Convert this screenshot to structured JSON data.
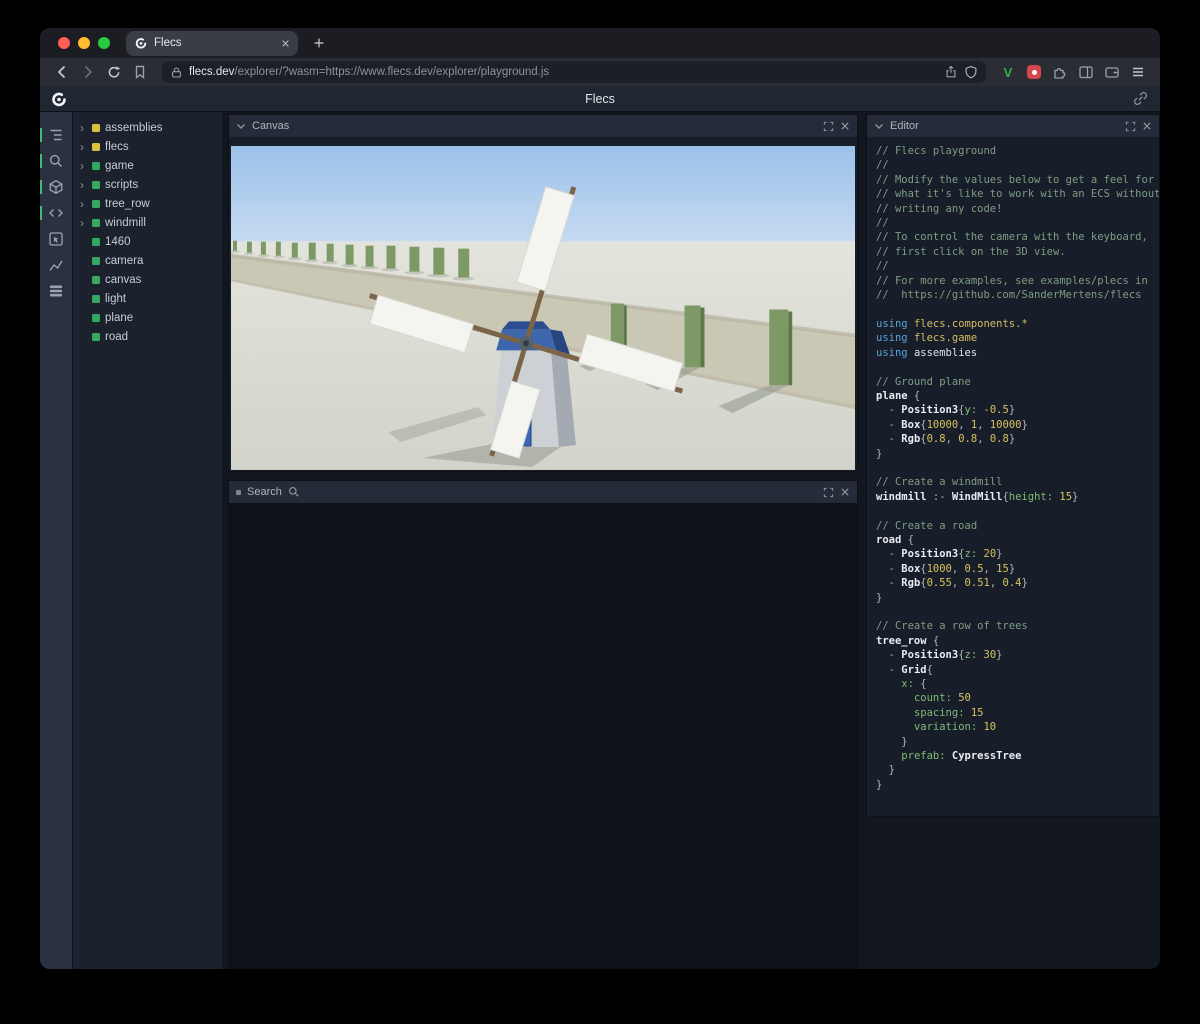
{
  "browser": {
    "tab_title": "Flecs",
    "url_domain": "flecs.dev",
    "url_path": "/explorer/?wasm=https://www.flecs.dev/explorer/playground.js",
    "extensions": {
      "v_label": "V"
    }
  },
  "header": {
    "title": "Flecs"
  },
  "toolbar": {
    "icons": [
      {
        "name": "entity-tree",
        "active": true
      },
      {
        "name": "search",
        "active": true
      },
      {
        "name": "assets",
        "active": true
      },
      {
        "name": "code",
        "active": true
      },
      {
        "name": "inspector",
        "active": false
      },
      {
        "name": "stats",
        "active": false
      },
      {
        "name": "queries",
        "active": false
      }
    ]
  },
  "entity_tree": {
    "items": [
      {
        "label": "assemblies",
        "type": "module",
        "expandable": true
      },
      {
        "label": "flecs",
        "type": "module",
        "expandable": true
      },
      {
        "label": "game",
        "type": "entity",
        "expandable": true
      },
      {
        "label": "scripts",
        "type": "entity",
        "expandable": true
      },
      {
        "label": "tree_row",
        "type": "entity",
        "expandable": true
      },
      {
        "label": "windmill",
        "type": "entity",
        "expandable": true
      },
      {
        "label": "1460",
        "type": "entity",
        "expandable": false
      },
      {
        "label": "camera",
        "type": "entity",
        "expandable": false
      },
      {
        "label": "canvas",
        "type": "entity",
        "expandable": false
      },
      {
        "label": "light",
        "type": "entity",
        "expandable": false
      },
      {
        "label": "plane",
        "type": "entity",
        "expandable": false
      },
      {
        "label": "road",
        "type": "entity",
        "expandable": false
      }
    ]
  },
  "panels": {
    "canvas": {
      "title": "Canvas"
    },
    "search": {
      "title": "Search"
    },
    "editor": {
      "title": "Editor"
    }
  },
  "colors": {
    "module_square": "#d9c33c",
    "entity_square": "#35a75f",
    "accent_green": "#43b97c",
    "editor_comment": "#7e9c82",
    "editor_keyword": "#56a2d8",
    "editor_number": "#d8c25e",
    "editor_attr": "#7fbb76"
  },
  "editor": {
    "lines": [
      [
        {
          "s": "c",
          "t": "// Flecs playground"
        }
      ],
      [
        {
          "s": "c",
          "t": "//"
        }
      ],
      [
        {
          "s": "c",
          "t": "// Modify the values below to get a feel for"
        }
      ],
      [
        {
          "s": "c",
          "t": "// what it's like to work with an ECS without"
        }
      ],
      [
        {
          "s": "c",
          "t": "// writing any code!"
        }
      ],
      [
        {
          "s": "c",
          "t": "//"
        }
      ],
      [
        {
          "s": "c",
          "t": "// To control the camera with the keyboard,"
        }
      ],
      [
        {
          "s": "c",
          "t": "// first click on the 3D view."
        }
      ],
      [
        {
          "s": "c",
          "t": "//"
        }
      ],
      [
        {
          "s": "c",
          "t": "// For more examples, see examples/plecs in"
        }
      ],
      [
        {
          "s": "c",
          "t": "//  https://github.com/SanderMertens/flecs"
        }
      ],
      [],
      [
        {
          "s": "k",
          "t": "using"
        },
        {
          "s": "p",
          "t": " "
        },
        {
          "s": "m",
          "t": "flecs.components.*"
        }
      ],
      [
        {
          "s": "k",
          "t": "using"
        },
        {
          "s": "p",
          "t": " "
        },
        {
          "s": "m",
          "t": "flecs.game"
        }
      ],
      [
        {
          "s": "k",
          "t": "using"
        },
        {
          "s": "p",
          "t": " "
        },
        {
          "s": "w",
          "t": "assemblies"
        }
      ],
      [],
      [
        {
          "s": "c",
          "t": "// Ground plane"
        }
      ],
      [
        {
          "s": "e",
          "t": "plane"
        },
        {
          "s": "p",
          "t": " {"
        }
      ],
      [
        {
          "s": "p",
          "t": "  - "
        },
        {
          "s": "e",
          "t": "Position3"
        },
        {
          "s": "p",
          "t": "{"
        },
        {
          "s": "a",
          "t": "y:"
        },
        {
          "s": "p",
          "t": " "
        },
        {
          "s": "n",
          "t": "-0.5"
        },
        {
          "s": "p",
          "t": "}"
        }
      ],
      [
        {
          "s": "p",
          "t": "  - "
        },
        {
          "s": "e",
          "t": "Box"
        },
        {
          "s": "p",
          "t": "{"
        },
        {
          "s": "n",
          "t": "10000"
        },
        {
          "s": "p",
          "t": ", "
        },
        {
          "s": "n",
          "t": "1"
        },
        {
          "s": "p",
          "t": ", "
        },
        {
          "s": "n",
          "t": "10000"
        },
        {
          "s": "p",
          "t": "}"
        }
      ],
      [
        {
          "s": "p",
          "t": "  - "
        },
        {
          "s": "e",
          "t": "Rgb"
        },
        {
          "s": "p",
          "t": "{"
        },
        {
          "s": "n",
          "t": "0.8"
        },
        {
          "s": "p",
          "t": ", "
        },
        {
          "s": "n",
          "t": "0.8"
        },
        {
          "s": "p",
          "t": ", "
        },
        {
          "s": "n",
          "t": "0.8"
        },
        {
          "s": "p",
          "t": "}"
        }
      ],
      [
        {
          "s": "p",
          "t": "}"
        }
      ],
      [],
      [
        {
          "s": "c",
          "t": "// Create a windmill"
        }
      ],
      [
        {
          "s": "e",
          "t": "windmill"
        },
        {
          "s": "p",
          "t": " :- "
        },
        {
          "s": "e",
          "t": "WindMill"
        },
        {
          "s": "p",
          "t": "{"
        },
        {
          "s": "a",
          "t": "height:"
        },
        {
          "s": "p",
          "t": " "
        },
        {
          "s": "n",
          "t": "15"
        },
        {
          "s": "p",
          "t": "}"
        }
      ],
      [],
      [
        {
          "s": "c",
          "t": "// Create a road"
        }
      ],
      [
        {
          "s": "e",
          "t": "road"
        },
        {
          "s": "p",
          "t": " {"
        }
      ],
      [
        {
          "s": "p",
          "t": "  - "
        },
        {
          "s": "e",
          "t": "Position3"
        },
        {
          "s": "p",
          "t": "{"
        },
        {
          "s": "a",
          "t": "z:"
        },
        {
          "s": "p",
          "t": " "
        },
        {
          "s": "n",
          "t": "20"
        },
        {
          "s": "p",
          "t": "}"
        }
      ],
      [
        {
          "s": "p",
          "t": "  - "
        },
        {
          "s": "e",
          "t": "Box"
        },
        {
          "s": "p",
          "t": "{"
        },
        {
          "s": "n",
          "t": "1000"
        },
        {
          "s": "p",
          "t": ", "
        },
        {
          "s": "n",
          "t": "0.5"
        },
        {
          "s": "p",
          "t": ", "
        },
        {
          "s": "n",
          "t": "15"
        },
        {
          "s": "p",
          "t": "}"
        }
      ],
      [
        {
          "s": "p",
          "t": "  - "
        },
        {
          "s": "e",
          "t": "Rgb"
        },
        {
          "s": "p",
          "t": "{"
        },
        {
          "s": "n",
          "t": "0.55"
        },
        {
          "s": "p",
          "t": ", "
        },
        {
          "s": "n",
          "t": "0.51"
        },
        {
          "s": "p",
          "t": ", "
        },
        {
          "s": "n",
          "t": "0.4"
        },
        {
          "s": "p",
          "t": "}"
        }
      ],
      [
        {
          "s": "p",
          "t": "}"
        }
      ],
      [],
      [
        {
          "s": "c",
          "t": "// Create a row of trees"
        }
      ],
      [
        {
          "s": "e",
          "t": "tree_row"
        },
        {
          "s": "p",
          "t": " {"
        }
      ],
      [
        {
          "s": "p",
          "t": "  - "
        },
        {
          "s": "e",
          "t": "Position3"
        },
        {
          "s": "p",
          "t": "{"
        },
        {
          "s": "a",
          "t": "z:"
        },
        {
          "s": "p",
          "t": " "
        },
        {
          "s": "n",
          "t": "30"
        },
        {
          "s": "p",
          "t": "}"
        }
      ],
      [
        {
          "s": "p",
          "t": "  - "
        },
        {
          "s": "e",
          "t": "Grid"
        },
        {
          "s": "p",
          "t": "{"
        }
      ],
      [
        {
          "s": "p",
          "t": "    "
        },
        {
          "s": "a",
          "t": "x:"
        },
        {
          "s": "p",
          "t": " {"
        }
      ],
      [
        {
          "s": "p",
          "t": "      "
        },
        {
          "s": "a",
          "t": "count:"
        },
        {
          "s": "p",
          "t": " "
        },
        {
          "s": "n",
          "t": "50"
        }
      ],
      [
        {
          "s": "p",
          "t": "      "
        },
        {
          "s": "a",
          "t": "spacing:"
        },
        {
          "s": "p",
          "t": " "
        },
        {
          "s": "n",
          "t": "15"
        }
      ],
      [
        {
          "s": "p",
          "t": "      "
        },
        {
          "s": "a",
          "t": "variation:"
        },
        {
          "s": "p",
          "t": " "
        },
        {
          "s": "n",
          "t": "10"
        }
      ],
      [
        {
          "s": "p",
          "t": "    }"
        }
      ],
      [
        {
          "s": "p",
          "t": "    "
        },
        {
          "s": "a",
          "t": "prefab:"
        },
        {
          "s": "p",
          "t": " "
        },
        {
          "s": "e",
          "t": "CypressTree"
        }
      ],
      [
        {
          "s": "p",
          "t": "  }"
        }
      ],
      [
        {
          "s": "p",
          "t": "}"
        }
      ]
    ]
  }
}
